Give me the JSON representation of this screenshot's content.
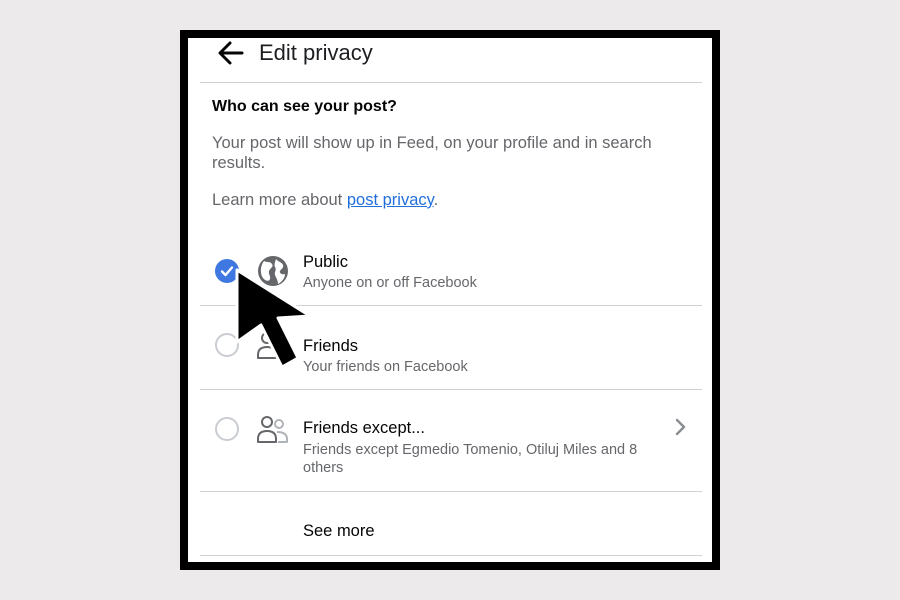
{
  "header": {
    "title": "Edit privacy"
  },
  "question": "Who can see your post?",
  "description": "Your post will show up in Feed, on your profile and in search results.",
  "learn_more": {
    "prefix": "Learn more about ",
    "link": "post privacy",
    "suffix": "."
  },
  "options": [
    {
      "title": "Public",
      "subtitle": "Anyone on or off Facebook",
      "icon": "globe-icon",
      "selected": true
    },
    {
      "title": "Friends",
      "subtitle": "Your friends on Facebook",
      "icon": "friends-icon",
      "selected": false
    },
    {
      "title": "Friends except...",
      "subtitle": "Friends except Egmedio Tomenio, Otiluj Miles and 8 others",
      "icon": "friends-except-icon",
      "selected": false
    }
  ],
  "see_more": "See more",
  "colors": {
    "accent": "#3f78e0",
    "link": "#216fdb",
    "divider": "#cfd1d4"
  }
}
